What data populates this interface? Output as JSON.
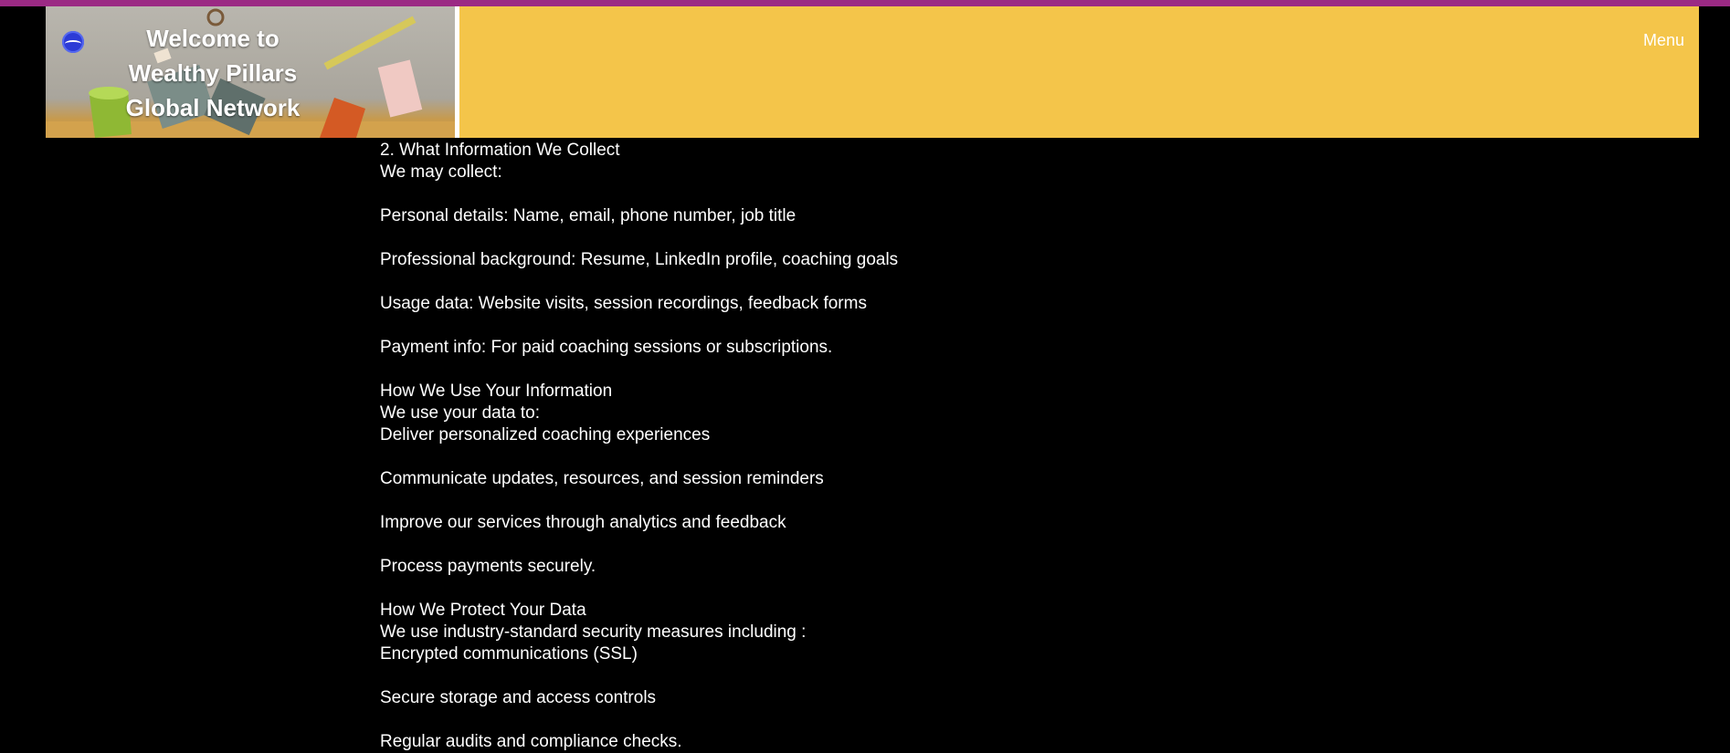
{
  "header": {
    "site_title_line1": "Welcome to",
    "site_title_line2": "Wealthy Pillars",
    "site_title_line3": "Global Network",
    "menu_label": "Menu",
    "logo_icon": "globe-logo-icon",
    "colors": {
      "header_bg": "#f4c54a",
      "top_strip": "#9b2a84",
      "page_bg": "#000000",
      "text": "#ffffff"
    }
  },
  "content": {
    "collect_heading": "2. What Information We Collect",
    "collect_intro": "We may collect:",
    "collect_personal": "Personal details: Name, email, phone number, job title",
    "collect_professional": "Professional background: Resume, LinkedIn profile, coaching goals",
    "collect_usage": "Usage data: Website visits, session recordings, feedback forms",
    "collect_payment": "Payment info: For paid coaching sessions or subscriptions.",
    "use_heading": "How We Use Your Information",
    "use_intro": "We use your data to:",
    "use_deliver": "Deliver personalized coaching experiences",
    "use_communicate": "Communicate updates, resources, and session reminders",
    "use_improve": "Improve our services through analytics and feedback",
    "use_process": "Process payments securely.",
    "protect_heading": "How We Protect Your Data",
    "protect_intro": "We use industry-standard security measures including :",
    "protect_encrypted": "Encrypted communications (SSL)",
    "protect_storage": "Secure storage and access controls",
    "protect_audits": "Regular audits and compliance checks."
  }
}
